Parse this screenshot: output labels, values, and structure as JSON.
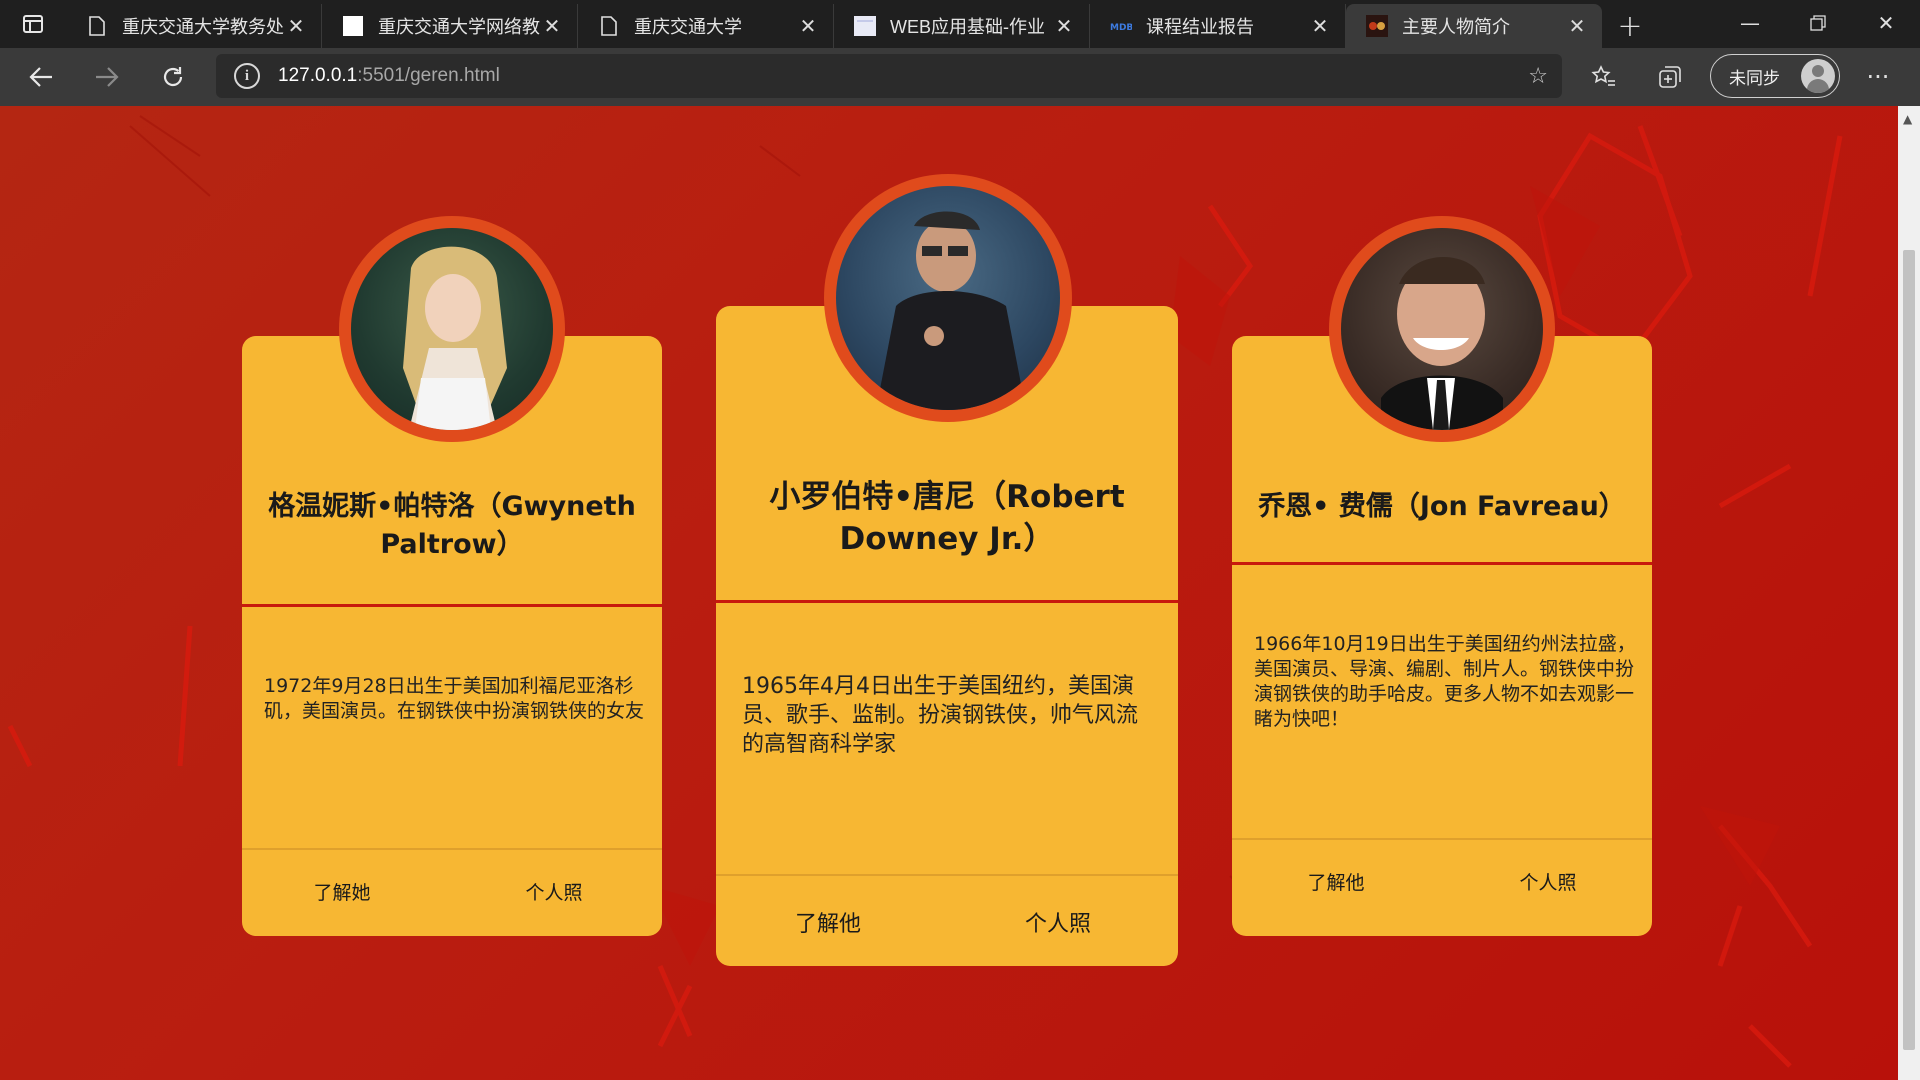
{
  "tabs": [
    {
      "title": "重庆交通大学教务处",
      "icon": "document-icon"
    },
    {
      "title": "重庆交通大学网络教",
      "icon": "blank-page-icon"
    },
    {
      "title": "重庆交通大学",
      "icon": "document-icon"
    },
    {
      "title": "WEB应用基础-作业",
      "icon": "page-icon"
    },
    {
      "title": "课程结业报告",
      "icon": "mdb-icon"
    },
    {
      "title": "主要人物简介",
      "icon": "site-icon",
      "active": true
    }
  ],
  "toolbar": {
    "url_host": "127.0.0.1",
    "url_rest": ":5501/geren.html",
    "sync_label": "未同步"
  },
  "cards": [
    {
      "name": "格温妮斯•帕特洛（Gwyneth Paltrow）",
      "description": "1972年9月28日出生于美国加利福尼亚洛杉矶，美国演员。在钢铁侠中扮演钢铁侠的女友",
      "link_about": "了解她",
      "link_photos": "个人照"
    },
    {
      "name": "小罗伯特•唐尼（Robert Downey Jr.）",
      "description": "1965年4月4日出生于美国纽约，美国演员、歌手、监制。扮演钢铁侠，帅气风流的高智商科学家",
      "link_about": "了解他",
      "link_photos": "个人照"
    },
    {
      "name": "乔恩• 费儒（Jon Favreau）",
      "description": "1966年10月19日出生于美国纽约州法拉盛，美国演员、导演、编剧、制片人。钢铁侠中扮演钢铁侠的助手哈皮。更多人物不如去观影一睹为快吧！",
      "link_about": "了解他",
      "link_photos": "个人照"
    }
  ],
  "colors": {
    "background": "#b91d10",
    "card": "#f7b733",
    "avatar_ring": "#e04b1c",
    "divider": "#c8190d"
  }
}
